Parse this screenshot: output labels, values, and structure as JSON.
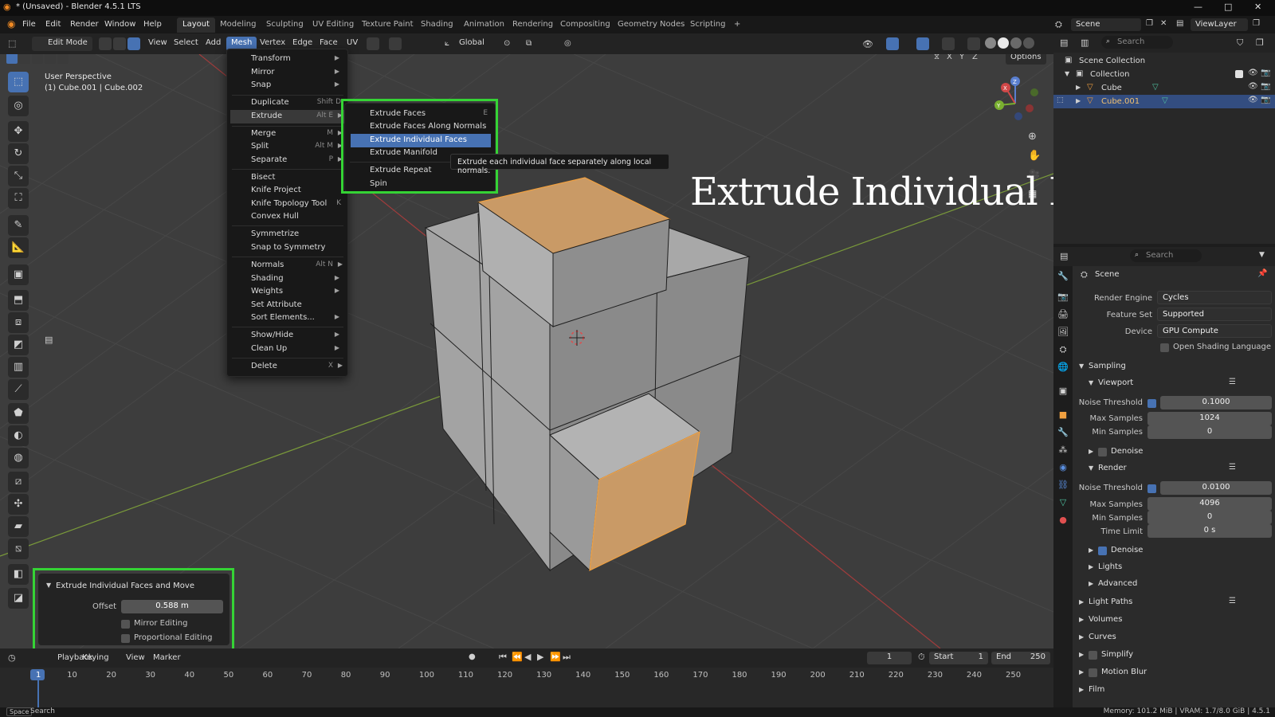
{
  "window": {
    "title": "* (Unsaved) - Blender 4.5.1 LTS",
    "controls": [
      "—",
      "□",
      "✕"
    ]
  },
  "menubar": {
    "items": [
      "File",
      "Edit",
      "Render",
      "Window",
      "Help"
    ]
  },
  "workspaces": {
    "tabs": [
      "Layout",
      "Modeling",
      "Sculpting",
      "UV Editing",
      "Texture Paint",
      "Shading",
      "Animation",
      "Rendering",
      "Compositing",
      "Geometry Nodes",
      "Scripting"
    ],
    "active": "Layout",
    "add": "+"
  },
  "scene": {
    "label": "Scene",
    "view_layer": "ViewLayer"
  },
  "viewport_header": {
    "mode": "Edit Mode",
    "menus": [
      "View",
      "Select",
      "Add",
      "Mesh",
      "Vertex",
      "Edge",
      "Face",
      "UV"
    ],
    "active_menu": "Mesh",
    "transform_orientation": "Global",
    "options": "Options",
    "axes": [
      "X",
      "Y",
      "Z"
    ]
  },
  "viewport": {
    "perspective": "User Perspective",
    "object_info": "(1) Cube.001 | Cube.002",
    "overlay_title": "Extrude Individual Faces",
    "gizmo": {
      "x": "X",
      "y": "Y",
      "z": "Z"
    }
  },
  "mesh_menu": {
    "items": [
      {
        "label": "Transform",
        "shortcut": "",
        "submenu": true
      },
      {
        "label": "Mirror",
        "shortcut": "",
        "submenu": true
      },
      {
        "label": "Snap",
        "shortcut": "",
        "submenu": true
      },
      {
        "label": "Duplicate",
        "shortcut": "Shift D",
        "submenu": false
      },
      {
        "label": "Extrude",
        "shortcut": "Alt E",
        "submenu": true
      },
      {
        "label": "Merge",
        "shortcut": "M",
        "submenu": true
      },
      {
        "label": "Split",
        "shortcut": "Alt M",
        "submenu": true
      },
      {
        "label": "Separate",
        "shortcut": "P",
        "submenu": true
      },
      {
        "label": "Bisect",
        "shortcut": "",
        "submenu": false
      },
      {
        "label": "Knife Project",
        "shortcut": "",
        "submenu": false
      },
      {
        "label": "Knife Topology Tool",
        "shortcut": "K",
        "submenu": false
      },
      {
        "label": "Convex Hull",
        "shortcut": "",
        "submenu": false
      },
      {
        "label": "Symmetrize",
        "shortcut": "",
        "submenu": false
      },
      {
        "label": "Snap to Symmetry",
        "shortcut": "",
        "submenu": false
      },
      {
        "label": "Normals",
        "shortcut": "Alt N",
        "submenu": true
      },
      {
        "label": "Shading",
        "shortcut": "",
        "submenu": true
      },
      {
        "label": "Weights",
        "shortcut": "",
        "submenu": true
      },
      {
        "label": "Set Attribute",
        "shortcut": "",
        "submenu": false
      },
      {
        "label": "Sort Elements...",
        "shortcut": "",
        "submenu": true
      },
      {
        "label": "Show/Hide",
        "shortcut": "",
        "submenu": true
      },
      {
        "label": "Clean Up",
        "shortcut": "",
        "submenu": true
      },
      {
        "label": "Delete",
        "shortcut": "X",
        "submenu": true
      }
    ],
    "highlighted": "Extrude"
  },
  "extrude_submenu": {
    "items": [
      {
        "label": "Extrude Faces",
        "shortcut": "E"
      },
      {
        "label": "Extrude Faces Along Normals",
        "shortcut": ""
      },
      {
        "label": "Extrude Individual Faces",
        "shortcut": ""
      },
      {
        "label": "Extrude Manifold",
        "shortcut": ""
      },
      {
        "label": "Extrude Repeat",
        "shortcut": ""
      },
      {
        "label": "Spin",
        "shortcut": ""
      }
    ],
    "highlighted": "Extrude Individual Faces",
    "tooltip": "Extrude each individual face separately along local normals."
  },
  "operator_panel": {
    "title": "Extrude Individual Faces and Move",
    "offset_label": "Offset",
    "offset_value": "0.588 m",
    "mirror_editing": "Mirror Editing",
    "proportional_editing": "Proportional Editing"
  },
  "timeline": {
    "menus": [
      "Playback",
      "Keying",
      "View",
      "Marker"
    ],
    "current_frame": "1",
    "start_label": "Start",
    "start": "1",
    "end_label": "End",
    "end": "250",
    "ticks": [
      "1",
      "10",
      "20",
      "30",
      "40",
      "50",
      "60",
      "70",
      "80",
      "90",
      "100",
      "110",
      "120",
      "130",
      "140",
      "150",
      "160",
      "170",
      "180",
      "190",
      "200",
      "210",
      "220",
      "230",
      "240",
      "250"
    ]
  },
  "statusbar": {
    "left_key": "Space",
    "left_label": "Search",
    "right": "Memory: 101.2 MiB | VRAM: 1.7/8.0 GiB | 4.5.1"
  },
  "outliner": {
    "search_placeholder": "Search",
    "rows": [
      {
        "label": "Scene Collection",
        "indent": 0,
        "selected": false
      },
      {
        "label": "Collection",
        "indent": 1,
        "selected": false
      },
      {
        "label": "Cube",
        "indent": 2,
        "selected": false
      },
      {
        "label": "Cube.001",
        "indent": 2,
        "selected": true
      }
    ]
  },
  "properties": {
    "search_placeholder": "Search",
    "context": "Scene",
    "render_engine_label": "Render Engine",
    "render_engine": "Cycles",
    "feature_set_label": "Feature Set",
    "feature_set": "Supported",
    "device_label": "Device",
    "device": "GPU Compute",
    "osl": "Open Shading Language",
    "sampling": "Sampling",
    "viewport": "Viewport",
    "vp_noise_label": "Noise Threshold",
    "vp_noise": "0.1000",
    "vp_max_label": "Max Samples",
    "vp_max": "1024",
    "vp_min_label": "Min Samples",
    "vp_min": "0",
    "vp_denoise": "Denoise",
    "render": "Render",
    "r_noise_label": "Noise Threshold",
    "r_noise": "0.0100",
    "r_max_label": "Max Samples",
    "r_max": "4096",
    "r_min_label": "Min Samples",
    "r_min": "0",
    "r_time_label": "Time Limit",
    "r_time": "0 s",
    "r_denoise": "Denoise",
    "lights": "Lights",
    "advanced": "Advanced",
    "light_paths": "Light Paths",
    "volumes": "Volumes",
    "curves": "Curves",
    "simplify": "Simplify",
    "motion_blur": "Motion Blur",
    "film": "Film"
  },
  "colors": {
    "accent": "#4772b3",
    "highlight_box": "#35d335",
    "selected_face": "#c99a66",
    "edge_select": "#f0a040"
  }
}
